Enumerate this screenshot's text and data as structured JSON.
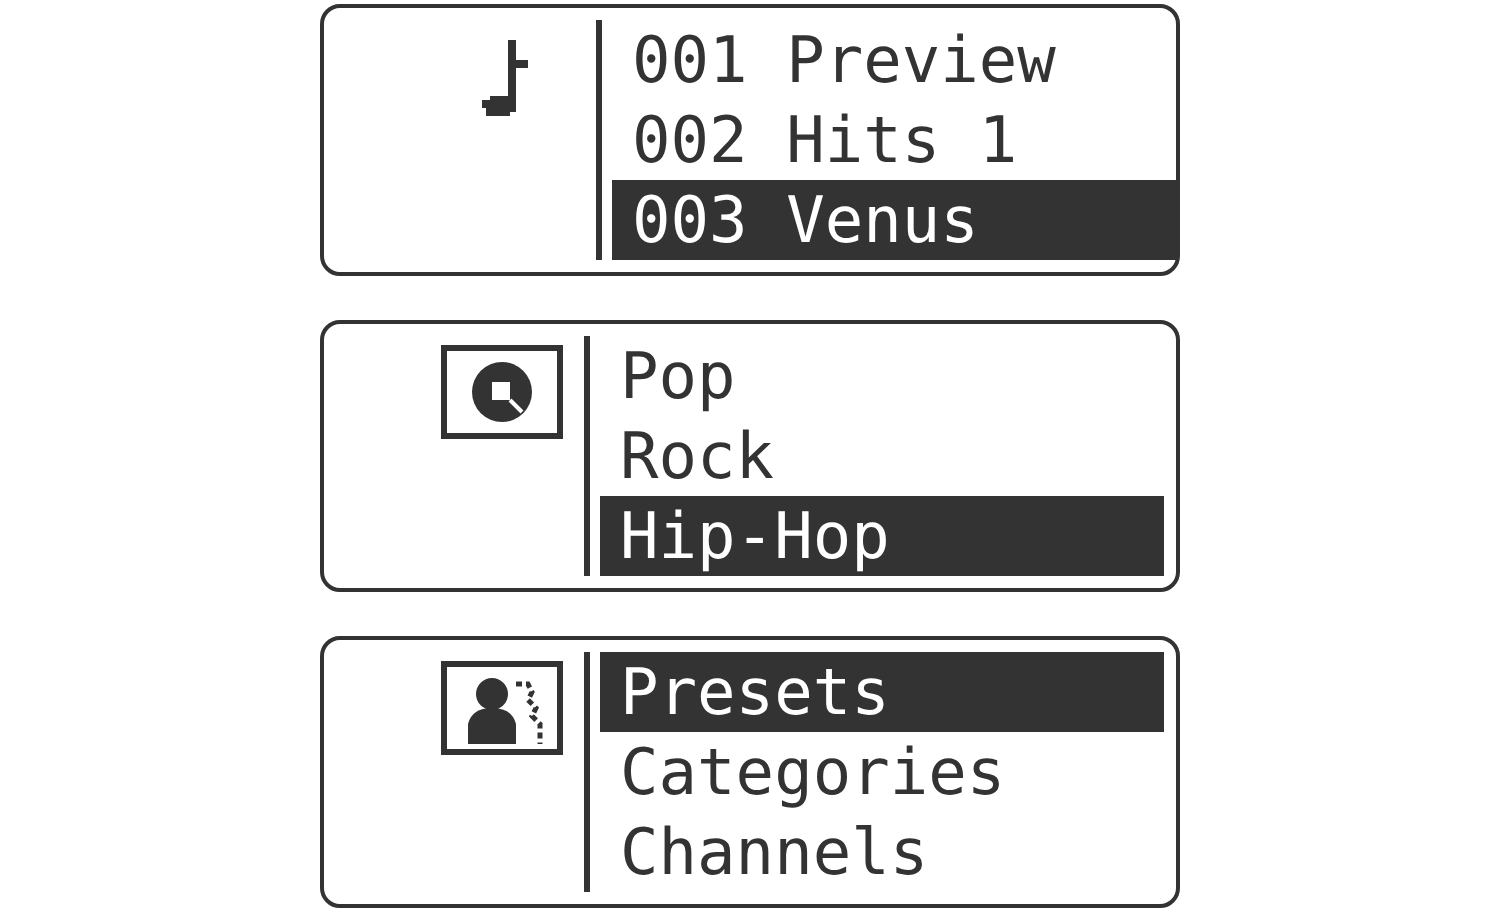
{
  "screens": [
    {
      "kind": "note",
      "items": [
        {
          "text": "001 Preview",
          "selected": false
        },
        {
          "text": "002 Hits 1",
          "selected": false
        },
        {
          "text": "003 Venus",
          "selected": true
        }
      ]
    },
    {
      "kind": "disc",
      "items": [
        {
          "text": "Pop",
          "selected": false
        },
        {
          "text": "Rock",
          "selected": false
        },
        {
          "text": "Hip-Hop",
          "selected": true
        }
      ]
    },
    {
      "kind": "person",
      "items": [
        {
          "text": "Presets",
          "selected": true
        },
        {
          "text": "Categories",
          "selected": false
        },
        {
          "text": "Channels",
          "selected": false
        }
      ]
    }
  ]
}
